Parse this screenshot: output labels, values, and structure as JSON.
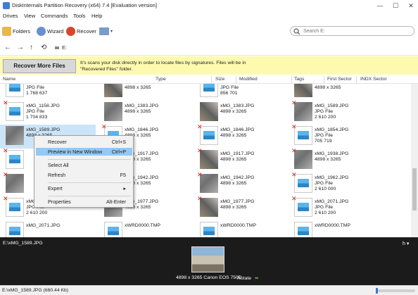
{
  "window": {
    "title": "DiskInternals Partition Recovery (x64) 7.4 [Evaluation version]",
    "controls": [
      "—",
      "☐",
      "✕"
    ]
  },
  "menu": [
    "Drives",
    "View",
    "Commands",
    "Tools",
    "Help"
  ],
  "toolbar": {
    "folders_label": "Folders",
    "wizard_label": "Wizard",
    "recover_label": "Recover",
    "search_placeholder": "Search E:"
  },
  "nav": {
    "back": "←",
    "forward": "→",
    "up": "↑",
    "history": "⟲",
    "drive": "E:"
  },
  "banner": {
    "button_label": "Recover More Files",
    "line1": "It's scans your disk directly in order to locate files by signatures. Files will be in",
    "line2": "\"Recovered Files\" folder."
  },
  "columns": [
    "Name",
    "Type",
    "Size",
    "Modified",
    "Tags",
    "First Sector",
    "INDX Sector"
  ],
  "rows": [
    [
      {
        "name": "",
        "l2": "JPG File",
        "l3": "1 768 637",
        "thumb": "doc",
        "x": false
      },
      {
        "name": "",
        "l2": "4898 x 3265",
        "l3": "",
        "thumb": "photo",
        "x": false
      },
      {
        "name": "",
        "l2": "JPG File",
        "l3": "856 701",
        "thumb": "doc",
        "x": false
      },
      {
        "name": "",
        "l2": "4898 x 3265",
        "l3": "",
        "thumb": "photo",
        "x": false
      }
    ],
    [
      {
        "name": "xMG_1158.JPG",
        "l2": "JPG File",
        "l3": "1 704 833",
        "thumb": "doc",
        "x": true
      },
      {
        "name": "xMG_1383.JPG",
        "l2": "4898 x 3265",
        "l3": "",
        "thumb": "photo",
        "x": false
      },
      {
        "name": "xMG_1383.JPG",
        "l2": "4898 x 3265",
        "l3": "",
        "thumb": "photo",
        "x": false
      },
      {
        "name": "xMG_1589.JPG",
        "l2": "JPG File",
        "l3": "2 610 200",
        "thumb": "photo",
        "x": true
      }
    ],
    [
      {
        "name": "xMG_1589.JPG",
        "l2": "4898 x 3265",
        "l3": "",
        "thumb": "photo",
        "x": false,
        "selected": true
      },
      {
        "name": "xMG_1846.JPG",
        "l2": "4898 x 3265",
        "l3": "",
        "thumb": "doc",
        "x": true
      },
      {
        "name": "xMG_1846.JPG",
        "l2": "4898 x 3265",
        "l3": "",
        "thumb": "doc",
        "x": true
      },
      {
        "name": "xMG_1854.JPG",
        "l2": "JPG File",
        "l3": "705 719",
        "thumb": "doc",
        "x": true
      }
    ],
    [
      {
        "name": "",
        "l2": "",
        "l3": "",
        "thumb": "doc",
        "x": true
      },
      {
        "name": "xMG_1917.JPG",
        "l2": "4898 x 3265",
        "l3": "",
        "thumb": "photo",
        "x": true
      },
      {
        "name": "xMG_1917.JPG",
        "l2": "4898 x 3265",
        "l3": "",
        "thumb": "photo",
        "x": true
      },
      {
        "name": "xMG_1938.JPG",
        "l2": "4898 x 3265",
        "l3": "",
        "thumb": "photo",
        "x": true
      }
    ],
    [
      {
        "name": "",
        "l2": "",
        "l3": "",
        "thumb": "photo",
        "x": true
      },
      {
        "name": "xMG_1942.JPG",
        "l2": "4898 x 3265",
        "l3": "",
        "thumb": "photo",
        "x": true
      },
      {
        "name": "xMG_1942.JPG",
        "l2": "4898 x 3265",
        "l3": "",
        "thumb": "photo",
        "x": true
      },
      {
        "name": "xMG_1962.JPG",
        "l2": "JPG File",
        "l3": "2 610 000",
        "thumb": "doc",
        "x": true
      }
    ],
    [
      {
        "name": "xMG_1967.JPG",
        "l2": "JPG File",
        "l3": "2 610 200",
        "thumb": "doc",
        "x": true
      },
      {
        "name": "xMG_1977.JPG",
        "l2": "4898 x 3265",
        "l3": "",
        "thumb": "photo",
        "x": true
      },
      {
        "name": "xMG_1977.JPG",
        "l2": "4898 x 3265",
        "l3": "",
        "thumb": "photo",
        "x": true
      },
      {
        "name": "xMG_2071.JPG",
        "l2": "JPG File",
        "l3": "2 610 200",
        "thumb": "doc",
        "x": true
      }
    ],
    [
      {
        "name": "xMG_2071.JPG",
        "l2": "",
        "l3": "",
        "thumb": "doc",
        "x": false
      },
      {
        "name": "xWRD0000.TMP",
        "l2": "",
        "l3": "",
        "thumb": "doc",
        "x": false
      },
      {
        "name": "xWRD0000.TMP",
        "l2": "",
        "l3": "",
        "thumb": "doc",
        "x": false
      },
      {
        "name": "xWRD0000.TMP",
        "l2": "",
        "l3": "",
        "thumb": "doc",
        "x": false
      }
    ]
  ],
  "context_menu": [
    {
      "label": "Recover",
      "shortcut": "Ctrl+S"
    },
    {
      "label": "Preview in New Window",
      "shortcut": "Ctrl+P",
      "highlighted": true
    },
    {
      "separator": true
    },
    {
      "label": "Select All",
      "shortcut": ""
    },
    {
      "label": "Refresh",
      "shortcut": "F5"
    },
    {
      "separator": true
    },
    {
      "label": "Expert",
      "shortcut": "▸"
    },
    {
      "separator": true
    },
    {
      "label": "Properties",
      "shortcut": "Alt-Enter"
    }
  ],
  "preview": {
    "path": "E:\\xMG_1589.JPG",
    "info": "4898 x 3265 Canon EOS 750D",
    "rotate_label": "Rotate",
    "h": "h ▾"
  },
  "status": {
    "text": "E:\\xMG_1589.JPG (660.44 Kb)"
  },
  "colors": {
    "banner": "#fdfab0",
    "selection": "#cce4f7",
    "menu_highlight": "#91c9f7",
    "preview_bg": "#1b1b1b",
    "deleted_mark": "#d82020"
  }
}
